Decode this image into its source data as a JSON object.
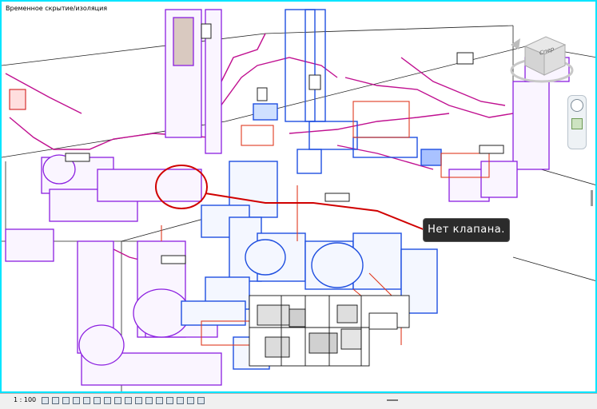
{
  "viewport": {
    "mode_label": "Временное скрытие/изоляция",
    "callout_text": "Нет клапана.",
    "border_color": "#00e5ff"
  },
  "viewcube": {
    "face_label": "Спер",
    "icon": "viewcube-icon"
  },
  "navbar": {
    "icons": [
      "steering-wheel-icon",
      "zoom-icon"
    ]
  },
  "statusbar": {
    "scale": "1 : 100",
    "icons": [
      "detail-level-icon",
      "visual-style-icon",
      "sun-path-icon",
      "shadows-icon",
      "render-icon",
      "crop-view-icon",
      "show-crop-icon",
      "lock-view-icon",
      "temp-hide-icon",
      "reveal-hidden-icon",
      "temp-view-props-icon",
      "highlight-displacement-icon",
      "analysis-icon",
      "constraints-icon",
      "worksharing-icon",
      "design-options-icon"
    ]
  },
  "colors": {
    "duct_purple": "#8b1fe0",
    "duct_blue": "#1f4fe0",
    "pipe_red": "#d21f1f",
    "magenta": "#c01090",
    "dark_unit": "#1a1a1a"
  }
}
